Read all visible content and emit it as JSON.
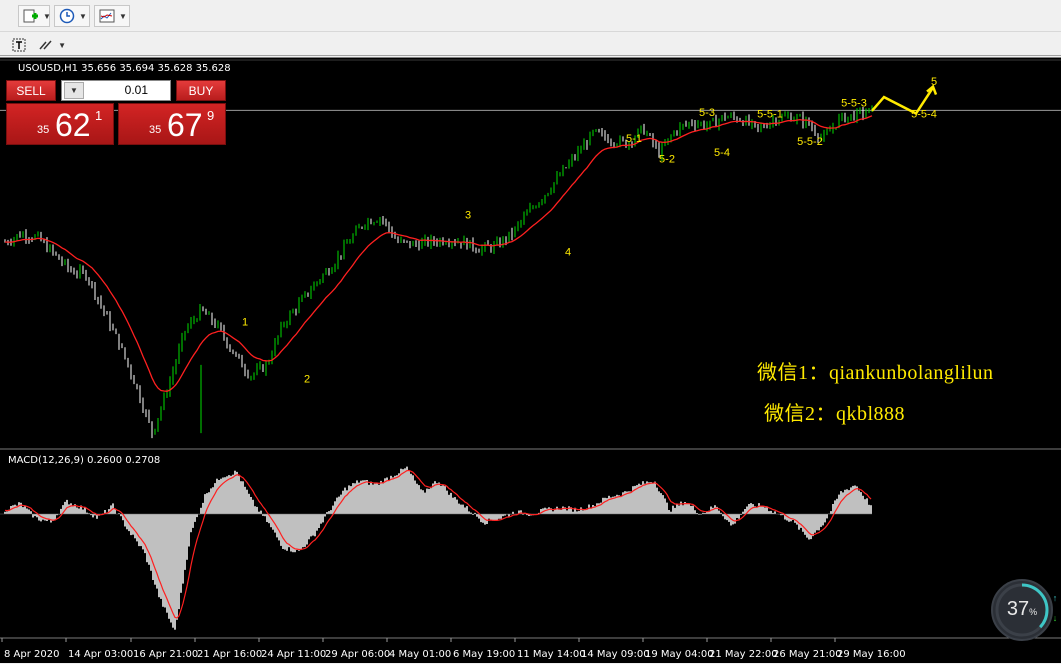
{
  "toolbar": {
    "row1_icons": [
      "new-order-icon",
      "history-icon",
      "charts-icon"
    ],
    "row2_icons": [
      "text-tool-icon",
      "line-tools-icon"
    ]
  },
  "chart_title": "USOUSD,H1 35.656 35.694 35.628 35.628",
  "trade_panel": {
    "sell_label": "SELL",
    "buy_label": "BUY",
    "lot": "0.01",
    "sell_prefix": "35",
    "sell_big": "62",
    "sell_sup": "1",
    "buy_prefix": "35",
    "buy_big": "67",
    "buy_sup": "9"
  },
  "watermark": {
    "line1": "微信1：qiankunbolanglilun",
    "line2": "微信2：qkbl888"
  },
  "macd_title": "MACD(12,26,9) 0.2600 0.2708",
  "progress": {
    "value": "37",
    "unit": "%"
  },
  "colors": {
    "bull_candle": "#00dd00",
    "bear_candle": "#ffffff",
    "ma_line": "#ff2020",
    "wave_label": "#ffea00",
    "macd_hist": "#c0c0c0",
    "macd_signal": "#ff2020"
  },
  "chart_data": {
    "type": "line",
    "title": "USOUSD,H1",
    "x_tick_labels": [
      "8 Apr 2020",
      "14 Apr 03:00",
      "16 Apr 21:00",
      "21 Apr 16:00",
      "24 Apr 11:00",
      "29 Apr 06:00",
      "4 May 01:00",
      "6 May 19:00",
      "11 May 14:00",
      "14 May 09:00",
      "19 May 04:00",
      "21 May 22:00",
      "26 May 21:00",
      "29 May 16:00"
    ],
    "series": [
      {
        "values": [
          26.0,
          26.6,
          26.3,
          25.1,
          23.9,
          23.6,
          21.0,
          18.5,
          15.5,
          12.0,
          15.5,
          19.5,
          21.0,
          19.8,
          17.8,
          16.2,
          17.0,
          20.0,
          21.5,
          23.0,
          24.3,
          26.0,
          27.5,
          27.8,
          26.0,
          25.8,
          26.0,
          26.2,
          26.0,
          25.5,
          25.7,
          26.6,
          28.2,
          29.5,
          31.0,
          32.5,
          34.0,
          33.5,
          33.2,
          34.3,
          32.5,
          34.2,
          34.8,
          34.5,
          35.2,
          35.0,
          34.2,
          35.0,
          35.2,
          34.8,
          33.5,
          35.0,
          35.3,
          35.6
        ]
      }
    ],
    "wave_labels": [
      {
        "label": "1",
        "value": 19.9
      },
      {
        "label": "2",
        "value": 15.7
      },
      {
        "label": "3",
        "value": 27.7
      },
      {
        "label": "4",
        "value": 25.0
      },
      {
        "label": "5-1",
        "value": 33.3
      },
      {
        "label": "5-2",
        "value": 31.8
      },
      {
        "label": "5-3",
        "value": 35.2
      },
      {
        "label": "5-4",
        "value": 32.3
      },
      {
        "label": "5-5-1",
        "value": 35.1
      },
      {
        "label": "5-5-2",
        "value": 33.1
      },
      {
        "label": "5-5-3",
        "value": 35.9
      },
      {
        "label": "5-5-4",
        "value": 35.1
      },
      {
        "label": "5",
        "value": 37.5
      }
    ],
    "projection": [
      35.6,
      36.6,
      35.4,
      37.3
    ],
    "current_price": 35.628,
    "macd": {
      "title": "MACD(12,26,9)",
      "main": 0.26,
      "signal": 0.2708,
      "histogram": [
        0.1,
        0.25,
        -0.1,
        -0.2,
        0.3,
        0.15,
        -0.1,
        0.2,
        -0.4,
        -0.9,
        -2.0,
        -2.8,
        -0.5,
        0.5,
        0.9,
        1.0,
        0.3,
        -0.2,
        -0.8,
        -0.9,
        -0.5,
        0.1,
        0.6,
        0.8,
        0.7,
        0.9,
        1.1,
        0.5,
        0.8,
        0.4,
        0.1,
        -0.2,
        -0.1,
        0.05,
        0.0,
        0.1,
        0.15,
        0.1,
        0.2,
        0.4,
        0.5,
        0.7,
        0.8,
        0.1,
        0.3,
        0.0,
        0.2,
        -0.3,
        0.2,
        0.2,
        0.0,
        -0.2,
        -0.6,
        -0.2,
        0.5,
        0.7,
        0.2
      ]
    }
  }
}
